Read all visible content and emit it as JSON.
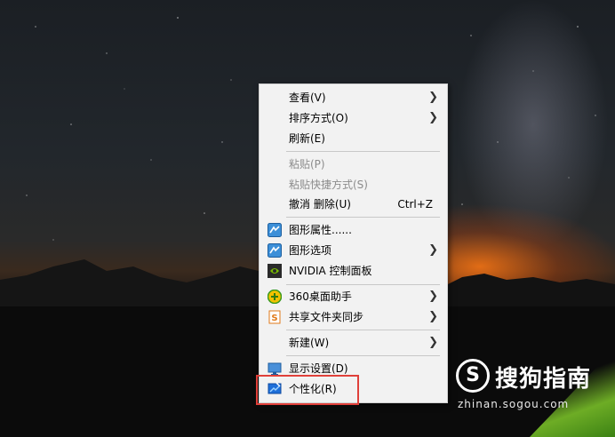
{
  "context_menu": {
    "items": [
      {
        "label": "查看(V)",
        "submenu": true,
        "icon": null,
        "disabled": false
      },
      {
        "label": "排序方式(O)",
        "submenu": true,
        "icon": null,
        "disabled": false
      },
      {
        "label": "刷新(E)",
        "submenu": false,
        "icon": null,
        "disabled": false
      },
      {
        "label": "粘贴(P)",
        "submenu": false,
        "icon": null,
        "disabled": true
      },
      {
        "label": "粘贴快捷方式(S)",
        "submenu": false,
        "icon": null,
        "disabled": true
      },
      {
        "label": "撤消 删除(U)",
        "shortcut": "Ctrl+Z",
        "submenu": false,
        "icon": null,
        "disabled": false
      },
      {
        "label": "图形属性......",
        "submenu": false,
        "icon": "intel-graphics-icon",
        "disabled": false
      },
      {
        "label": "图形选项",
        "submenu": true,
        "icon": "intel-graphics-icon",
        "disabled": false
      },
      {
        "label": "NVIDIA 控制面板",
        "submenu": false,
        "icon": "nvidia-icon",
        "disabled": false
      },
      {
        "label": "360桌面助手",
        "submenu": true,
        "icon": "360-icon",
        "disabled": false
      },
      {
        "label": "共享文件夹同步",
        "submenu": true,
        "icon": "sync-folder-icon",
        "disabled": false
      },
      {
        "label": "新建(W)",
        "submenu": true,
        "icon": null,
        "disabled": false
      },
      {
        "label": "显示设置(D)",
        "submenu": false,
        "icon": "display-icon",
        "disabled": false
      },
      {
        "label": "个性化(R)",
        "submenu": false,
        "icon": "personalize-icon",
        "disabled": false
      }
    ],
    "arrow_glyph": "❯",
    "highlight_color": "#e0403a"
  },
  "watermark": {
    "logo_letter": "S",
    "title": "搜狗指南",
    "url": "zhinan.sogou.com"
  }
}
